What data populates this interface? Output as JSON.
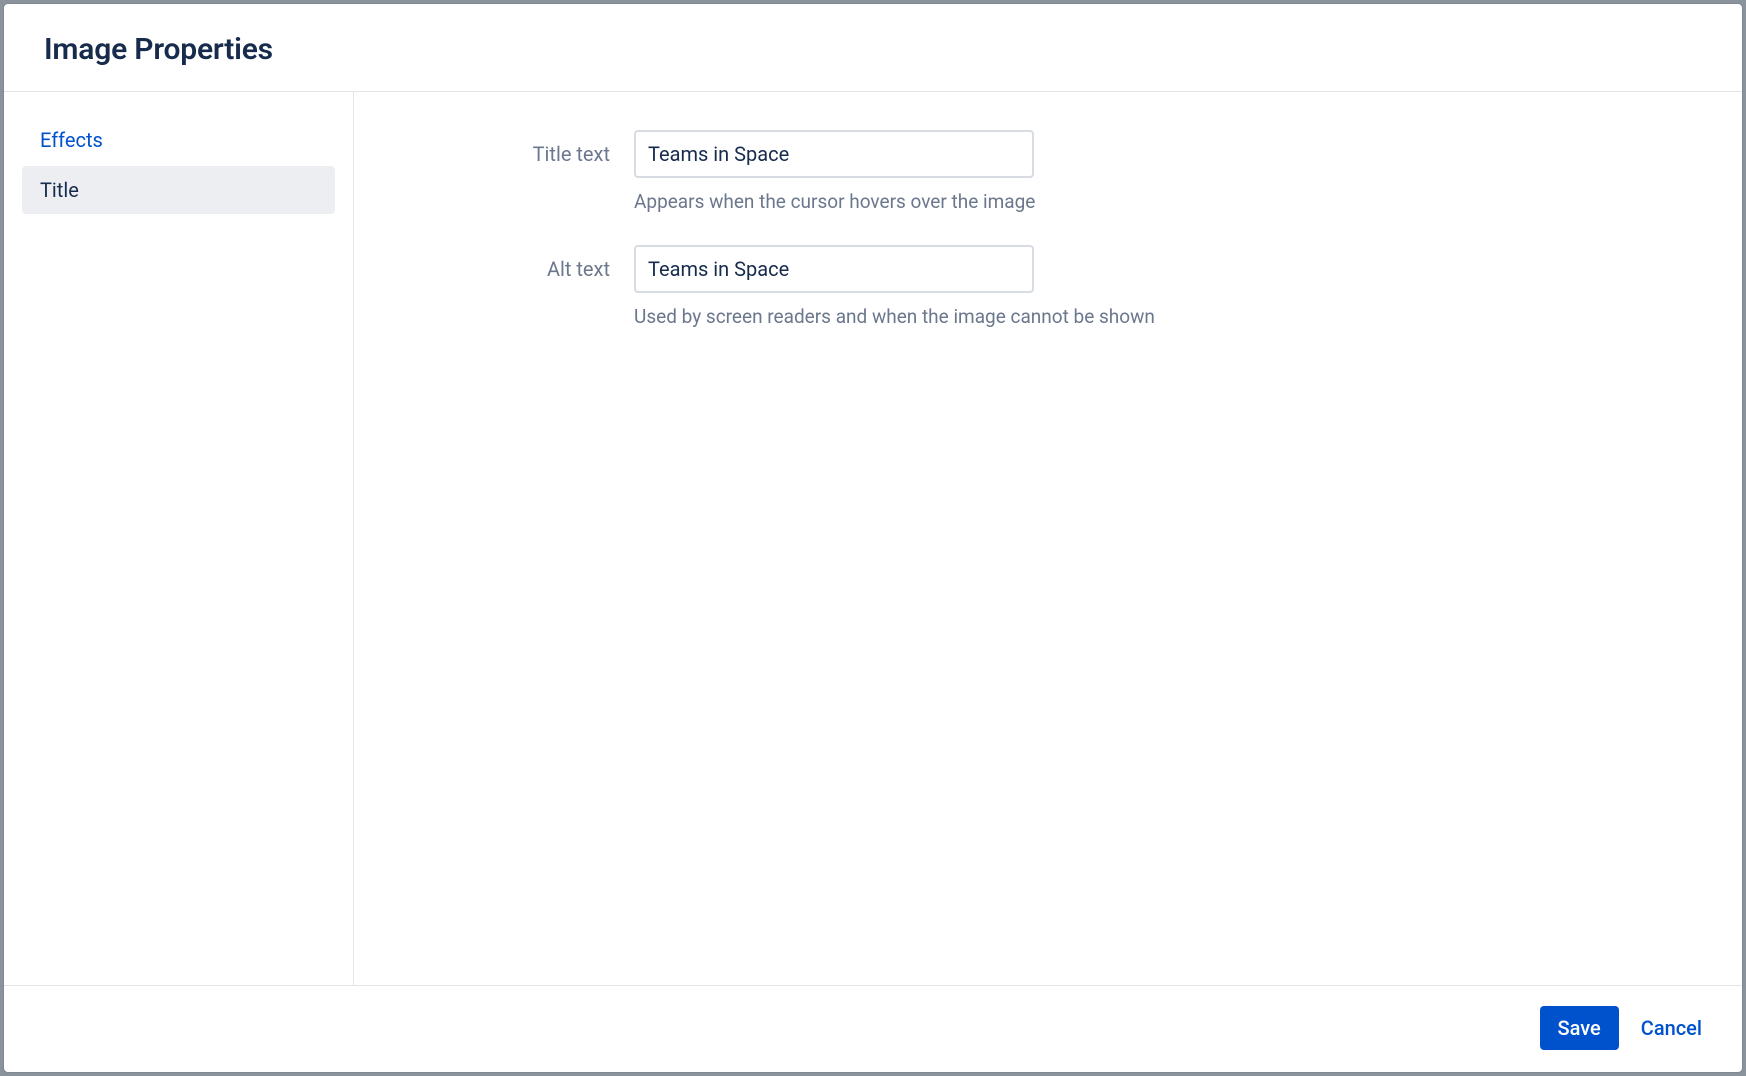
{
  "dialog": {
    "title": "Image Properties"
  },
  "sidebar": {
    "items": [
      {
        "label": "Effects",
        "active": false
      },
      {
        "label": "Title",
        "active": true
      }
    ]
  },
  "form": {
    "titleText": {
      "label": "Title text",
      "value": "Teams in Space",
      "hint": "Appears when the cursor hovers over the image"
    },
    "altText": {
      "label": "Alt text",
      "value": "Teams in Space",
      "hint": "Used by screen readers and when the image cannot be shown"
    }
  },
  "footer": {
    "save": "Save",
    "cancel": "Cancel"
  }
}
